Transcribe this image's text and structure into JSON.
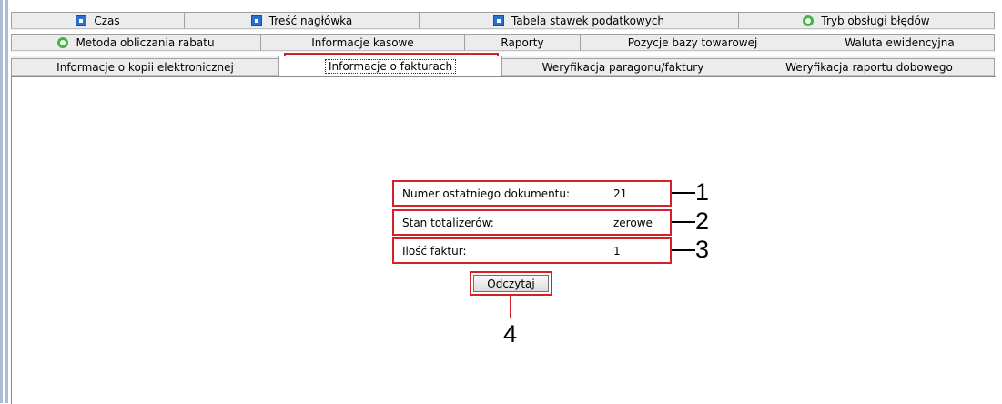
{
  "tabs": {
    "row1": [
      {
        "label": "Czas",
        "icon": "blue-square-icon"
      },
      {
        "label": "Treść nagłówka",
        "icon": "blue-square-icon"
      },
      {
        "label": "Tabela stawek podatkowych",
        "icon": "blue-square-icon"
      },
      {
        "label": "Tryb obsługi błędów",
        "icon": "green-circle-icon"
      }
    ],
    "row2": [
      {
        "label": "Metoda obliczania rabatu",
        "icon": "green-circle-icon"
      },
      {
        "label": "Informacje kasowe"
      },
      {
        "label": "Raporty"
      },
      {
        "label": "Pozycje bazy towarowej"
      },
      {
        "label": "Waluta ewidencyjna"
      }
    ],
    "row3": [
      {
        "label": "Informacje o kopii elektronicznej"
      },
      {
        "label": "Informacje o fakturach",
        "selected": true
      },
      {
        "label": "Weryfikacja paragonu/faktury"
      },
      {
        "label": "Weryfikacja raportu dobowego"
      }
    ]
  },
  "fields": [
    {
      "label": "Numer ostatniego dokumentu:",
      "value": "21"
    },
    {
      "label": "Stan totalizerów:",
      "value": "zerowe"
    },
    {
      "label": "Ilość faktur:",
      "value": "1"
    }
  ],
  "read_button": {
    "label": "Odczytaj"
  },
  "callouts": [
    "1",
    "2",
    "3",
    "4"
  ],
  "colors": {
    "highlight": "#d62027",
    "icon_blue": "#2a6fd1",
    "icon_green": "#3fb83f"
  }
}
